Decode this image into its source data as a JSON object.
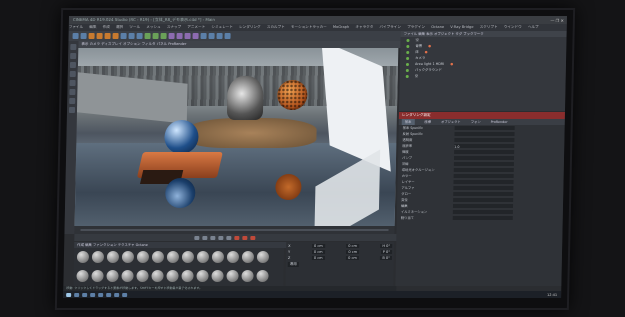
{
  "app": {
    "title": "CINEMA 4D R19.024 Studio (RC - R19) - [立体_R8_デモ表示.c4d *] - Main",
    "window_controls": "—  ❐  ✕"
  },
  "menu": [
    "ファイル",
    "編集",
    "作成",
    "選択",
    "ツール",
    "メッシュ",
    "スナップ",
    "アニメート",
    "シミュレート",
    "レンダリング",
    "スカルプト",
    "モーショントラッカー",
    "MoGraph",
    "キャラクタ",
    "パイプライン",
    "プラグイン",
    "Octane",
    "V-Ray Bridge",
    "スクリプト",
    "ウインドウ",
    "ヘルプ"
  ],
  "viewport": {
    "menu": "表示  カメラ  ディスプレイ  オプション  フィルタ  パネル  ProRender"
  },
  "materials": {
    "menu": "作成  編集  ファンクション  テクスチャ  Octane",
    "items": [
      "Mat",
      "Mat.1",
      "Mat.2",
      "Mat.3",
      "Mat.4",
      "Mat.5",
      "Mat.6",
      "Mat.7",
      "Mat.8",
      "Mat.9",
      "Mat.10",
      "Mat.11",
      "Mat.12",
      "Mat.13",
      "Mat.14",
      "Mat.15",
      "Mat.16",
      "Mat.17",
      "Mat.18",
      "Mat.19",
      "Mat.20",
      "Mat.21",
      "Mat.22",
      "Mat.23",
      "Mat.24",
      "Mat.25"
    ]
  },
  "coordinates": {
    "rows": [
      {
        "axis": "X",
        "pos": "0 cm",
        "size": "0 cm",
        "rot": "H 0°"
      },
      {
        "axis": "Y",
        "pos": "0 cm",
        "size": "0 cm",
        "rot": "P 0°"
      },
      {
        "axis": "Z",
        "pos": "0 cm",
        "size": "0 cm",
        "rot": "B 0°"
      }
    ],
    "apply": "適用"
  },
  "status": "移動: クリックしてドラッグすると要素が移動します。SHIFTキーを押すと移動量が量子化されます。",
  "objects": {
    "header": "ファイル  編集  表示  オブジェクト  タグ  ブックマーク",
    "items": [
      {
        "name": "空",
        "tag": ""
      },
      {
        "name": "背景",
        "tag": "●"
      },
      {
        "name": "床",
        "tag": "●"
      },
      {
        "name": "カメラ",
        "tag": ""
      },
      {
        "name": "Area light 1 HDRI",
        "tag": "●"
      },
      {
        "name": "バックグラウンド",
        "tag": ""
      },
      {
        "name": "空",
        "tag": ""
      }
    ]
  },
  "attributes": {
    "title": "レンダリング設定",
    "tabs": [
      "基本",
      "座標",
      "オブジェクト",
      "フォン",
      "ProRender"
    ],
    "rows": [
      {
        "label": "基本 Specific",
        "value": ""
      },
      {
        "label": "反射 Specific",
        "value": ""
      },
      {
        "label": "透明度",
        "value": ""
      },
      {
        "label": "屈折率",
        "value": "1.0"
      },
      {
        "label": "輝度",
        "value": ""
      },
      {
        "label": "バンプ",
        "value": ""
      },
      {
        "label": "法線",
        "value": ""
      },
      {
        "label": "環境光オクルージョン",
        "value": ""
      },
      {
        "label": "カラー",
        "value": ""
      },
      {
        "label": "レイヤー",
        "value": ""
      },
      {
        "label": "アルファ",
        "value": ""
      },
      {
        "label": "グロー",
        "value": ""
      },
      {
        "label": "変位",
        "value": ""
      },
      {
        "label": "編集",
        "value": ""
      },
      {
        "label": "イルミネーション",
        "value": ""
      },
      {
        "label": "割り当て",
        "value": ""
      }
    ]
  },
  "taskbar": {
    "clock": "12:41"
  }
}
